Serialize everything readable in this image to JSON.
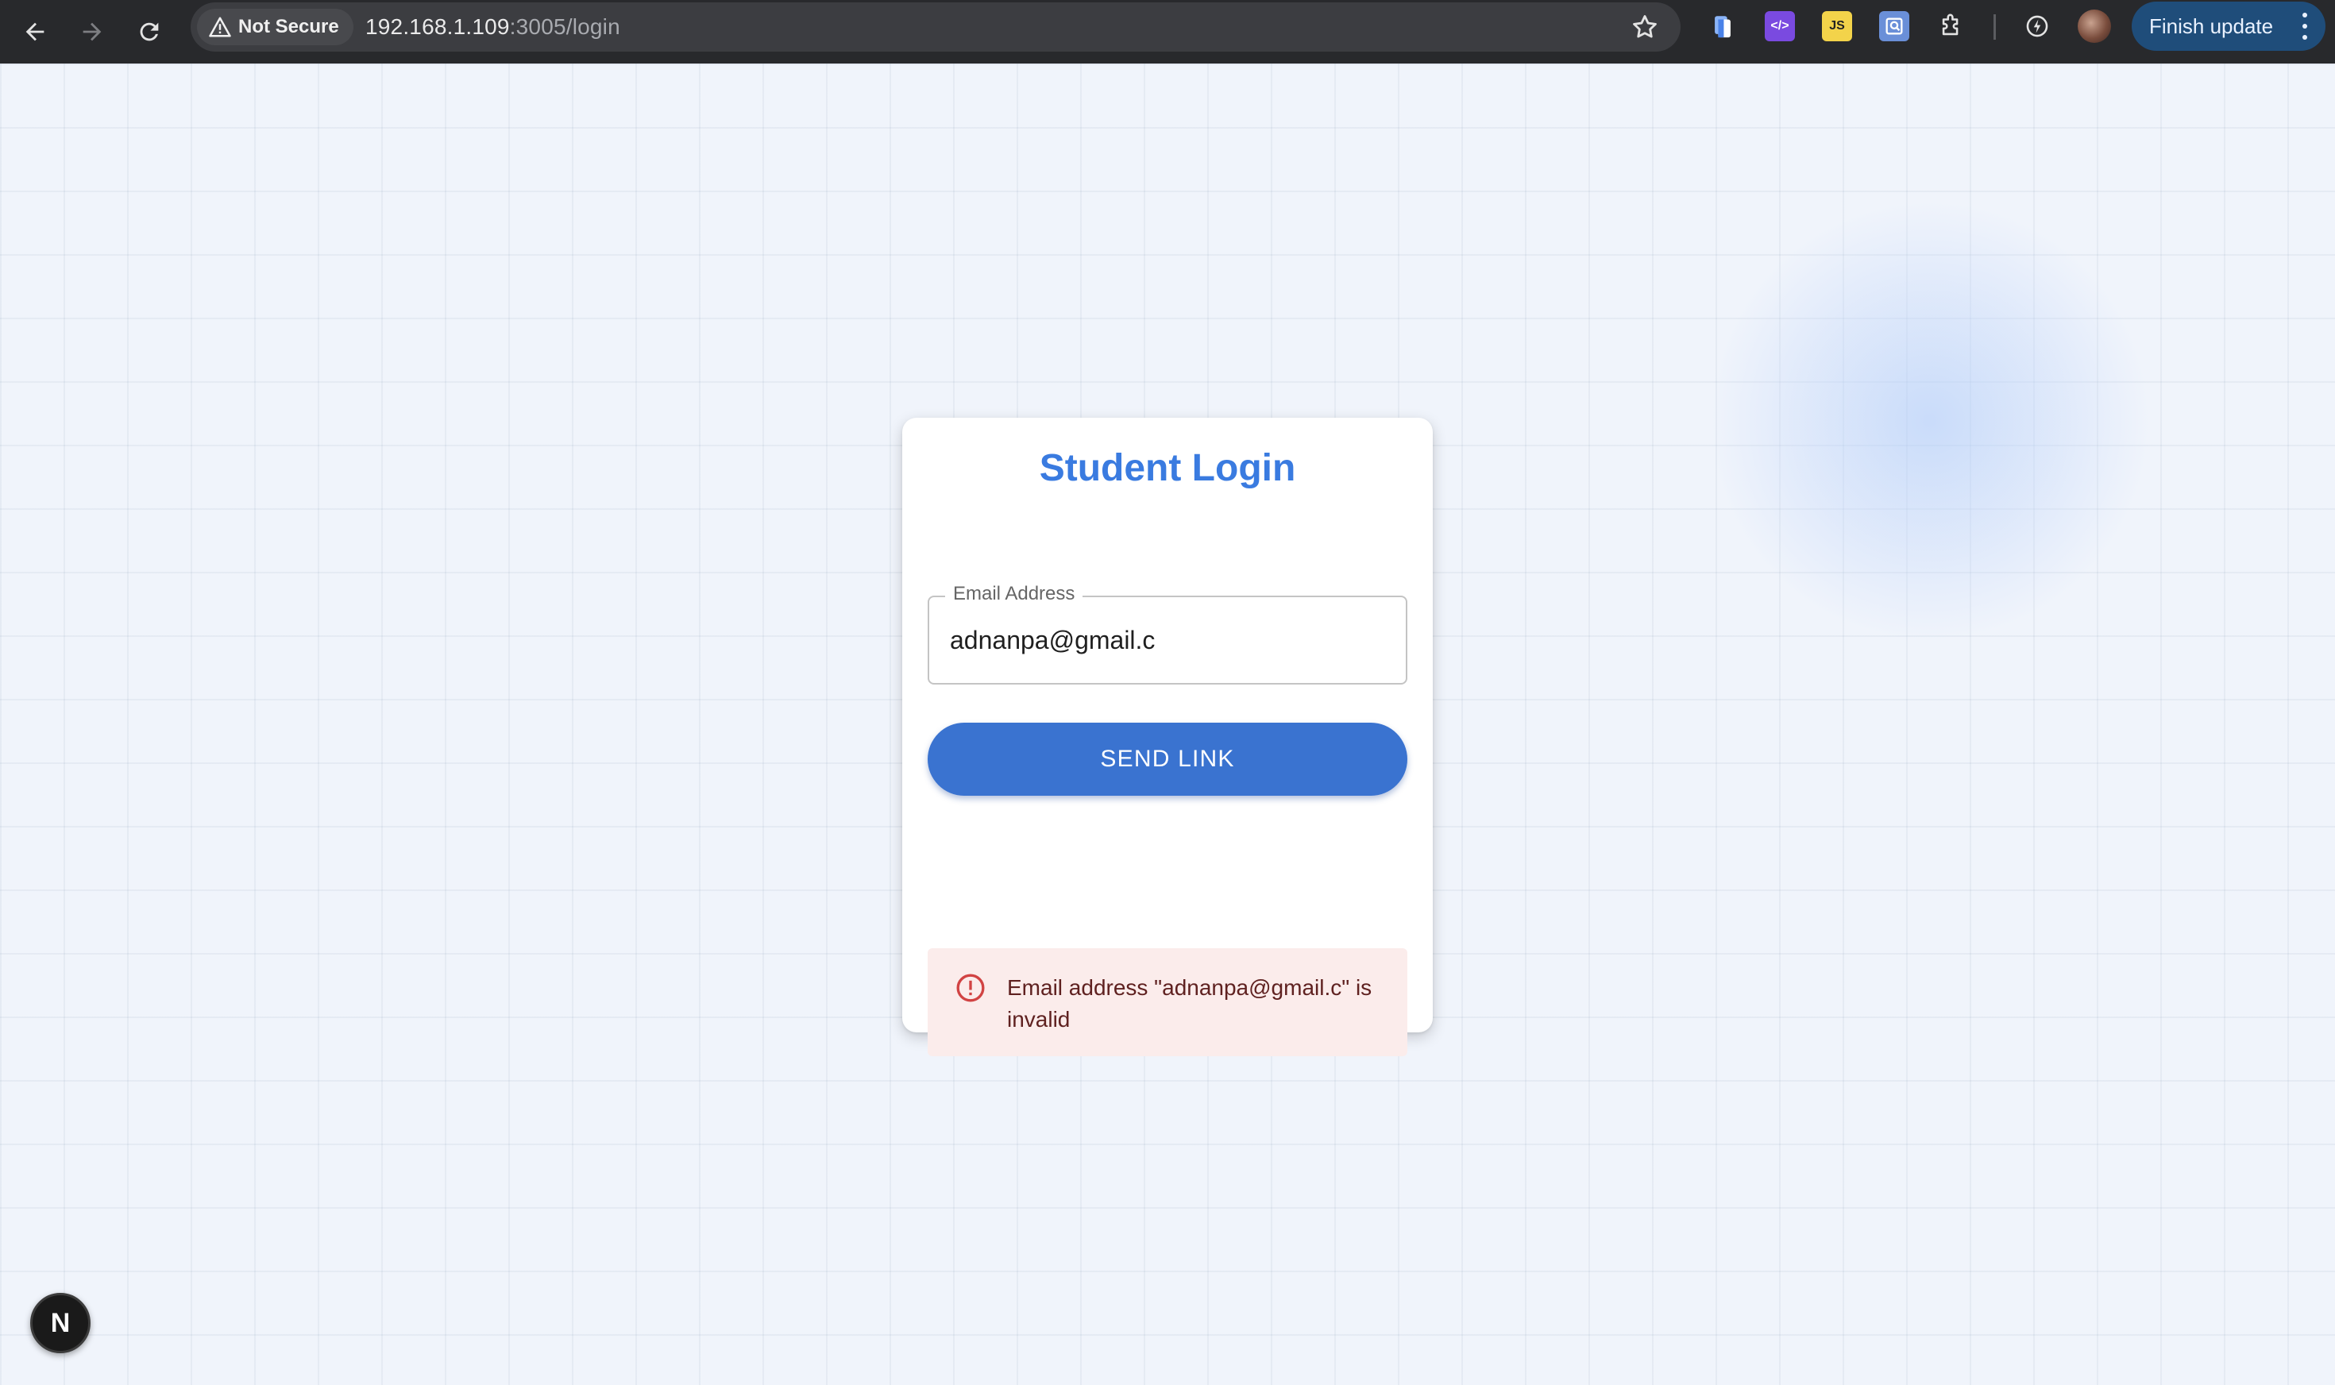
{
  "browser": {
    "security_label": "Not Secure",
    "url_host": "192.168.1.109",
    "url_path": ":3005/login",
    "finish_update_label": "Finish update",
    "icons": [
      "back-icon",
      "forward-icon",
      "reload-icon",
      "warning-icon",
      "bookmark-star-icon",
      "extension-icon",
      "profile-avatar",
      "more-vert-icon"
    ]
  },
  "login": {
    "title": "Student Login",
    "email_label": "Email Address",
    "email_value": "adnanpa@gmail.c",
    "send_button_label": "SEND LINK",
    "error_message": "Email address \"adnanpa@gmail.c\" is invalid"
  },
  "dev": {
    "badge_label": "N"
  },
  "colors": {
    "title": "#3a7be0",
    "button": "#3a73d0",
    "alert_bg": "#fbeceb",
    "alert_text": "#5f2120",
    "alert_icon": "#d14343",
    "chrome_bg": "#28292c",
    "finish_update_bg": "#1f4d7a"
  }
}
